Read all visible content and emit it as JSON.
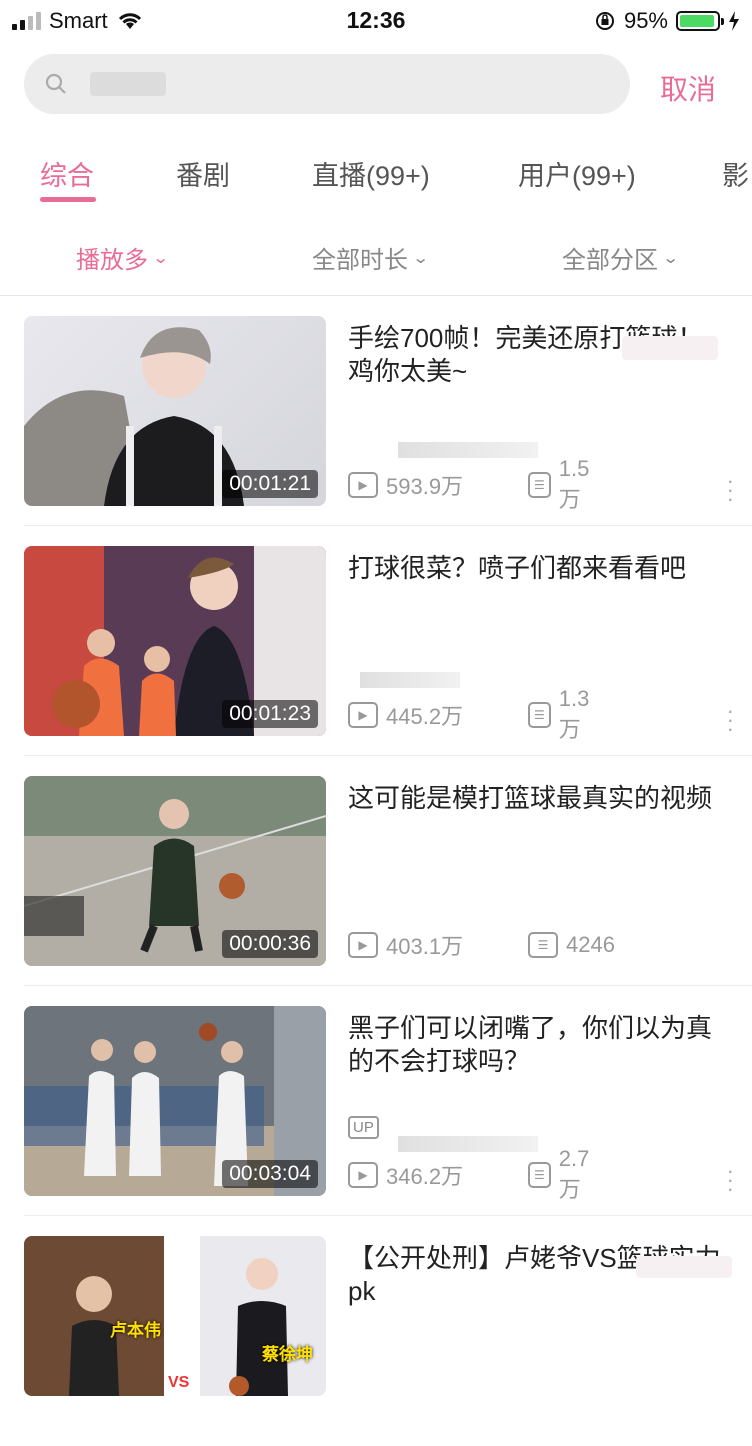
{
  "status": {
    "carrier": "Smart",
    "time": "12:36",
    "battery": "95%",
    "battery_level": 0.95
  },
  "search": {
    "value": "",
    "placeholder": "",
    "cancel": "取消"
  },
  "tabs": [
    "综合",
    "番剧",
    "直播(99+)",
    "用户(99+)",
    "影"
  ],
  "filters": [
    "播放多",
    "全部时长",
    "全部分区"
  ],
  "videos": [
    {
      "title": "手绘700帧！完美还原打篮球！鸡你太美~",
      "duration": "00:01:21",
      "plays": "593.9万",
      "danmaku": "1.5万"
    },
    {
      "title": "打球很菜？喷子们都来看看吧",
      "duration": "00:01:23",
      "plays": "445.2万",
      "danmaku": "1.3万"
    },
    {
      "title": "这可能是模打篮球最真实的视频",
      "duration": "00:00:36",
      "plays": "403.1万",
      "danmaku": "4246"
    },
    {
      "title": "黑子们可以闭嘴了，你们以为真的不会打球吗？",
      "duration": "00:03:04",
      "plays": "346.2万",
      "danmaku": "2.7万",
      "up_badge": "UP"
    },
    {
      "title": "【公开处刑】卢姥爷VS篮球实力pk",
      "thumb_left_label": "卢本伟",
      "thumb_vs": "VS",
      "thumb_right_label": "蔡徐坤"
    }
  ],
  "colors": {
    "accent": "#e96c94",
    "battery": "#4cd964"
  }
}
